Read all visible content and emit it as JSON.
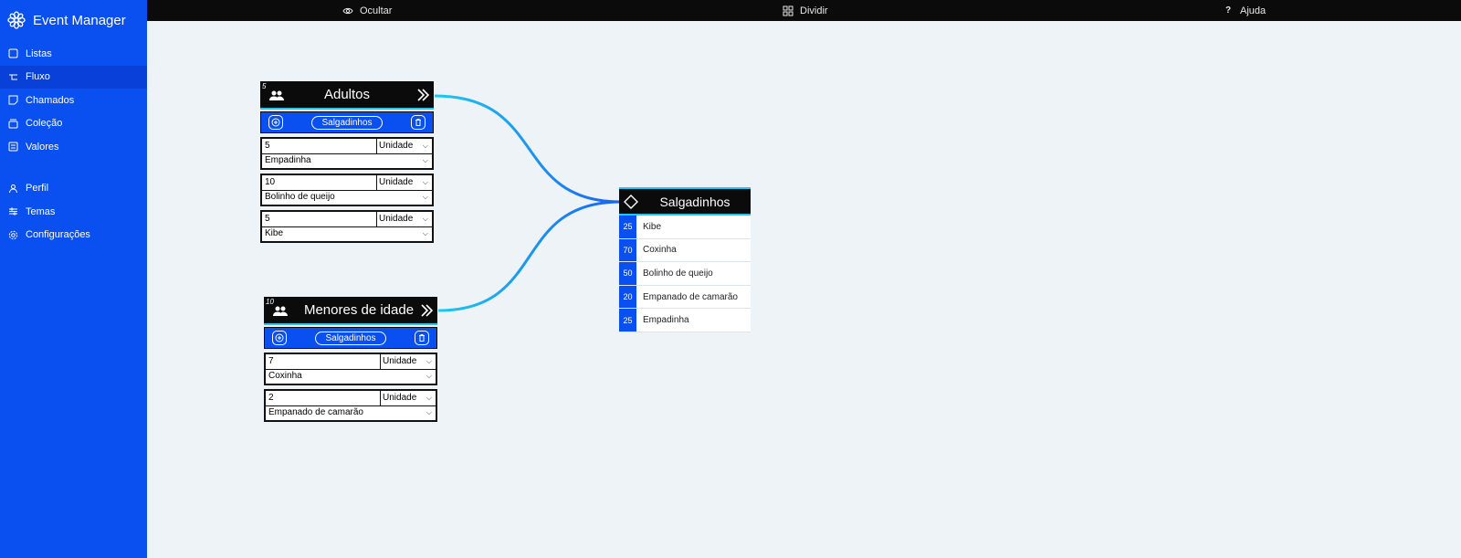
{
  "app": {
    "title": "Event Manager"
  },
  "sidebar": {
    "items": [
      {
        "label": "Listas",
        "icon": "list-icon"
      },
      {
        "label": "Fluxo",
        "icon": "flow-icon",
        "active": true
      },
      {
        "label": "Chamados",
        "icon": "ticket-icon"
      },
      {
        "label": "Coleção",
        "icon": "collection-icon"
      },
      {
        "label": "Valores",
        "icon": "values-icon"
      }
    ],
    "items2": [
      {
        "label": "Perfil",
        "icon": "user-icon"
      },
      {
        "label": "Temas",
        "icon": "themes-icon"
      },
      {
        "label": "Configurações",
        "icon": "gear-icon"
      }
    ]
  },
  "topbar": {
    "hide_label": "Ocultar",
    "split_label": "Dividir",
    "help_label": "Ajuda",
    "help_icon": "?"
  },
  "groups": [
    {
      "count": "5",
      "title": "Adultos",
      "pill": "Salgadinhos",
      "items": [
        {
          "qty": "5",
          "unit": "Unidade",
          "name": "Empadinha"
        },
        {
          "qty": "10",
          "unit": "Unidade",
          "name": "Bolinho de queijo"
        },
        {
          "qty": "5",
          "unit": "Unidade",
          "name": "Kibe"
        }
      ]
    },
    {
      "count": "10",
      "title": "Menores de idade",
      "pill": "Salgadinhos",
      "items": [
        {
          "qty": "7",
          "unit": "Unidade",
          "name": "Coxinha"
        },
        {
          "qty": "2",
          "unit": "Unidade",
          "name": "Empanado de camarão"
        }
      ]
    }
  ],
  "target": {
    "title": "Salgadinhos",
    "rows": [
      {
        "n": "25",
        "name": "Kibe"
      },
      {
        "n": "70",
        "name": "Coxinha"
      },
      {
        "n": "50",
        "name": "Bolinho de queijo"
      },
      {
        "n": "20",
        "name": "Empanado de camarão"
      },
      {
        "n": "25",
        "name": "Empadinha"
      }
    ]
  },
  "colors": {
    "sidebar": "#0a4ff0",
    "active": "#0840d8",
    "wire_from": "#1ec8f0",
    "wire_to": "#1a63f0",
    "dark": "#0b0b0b"
  }
}
